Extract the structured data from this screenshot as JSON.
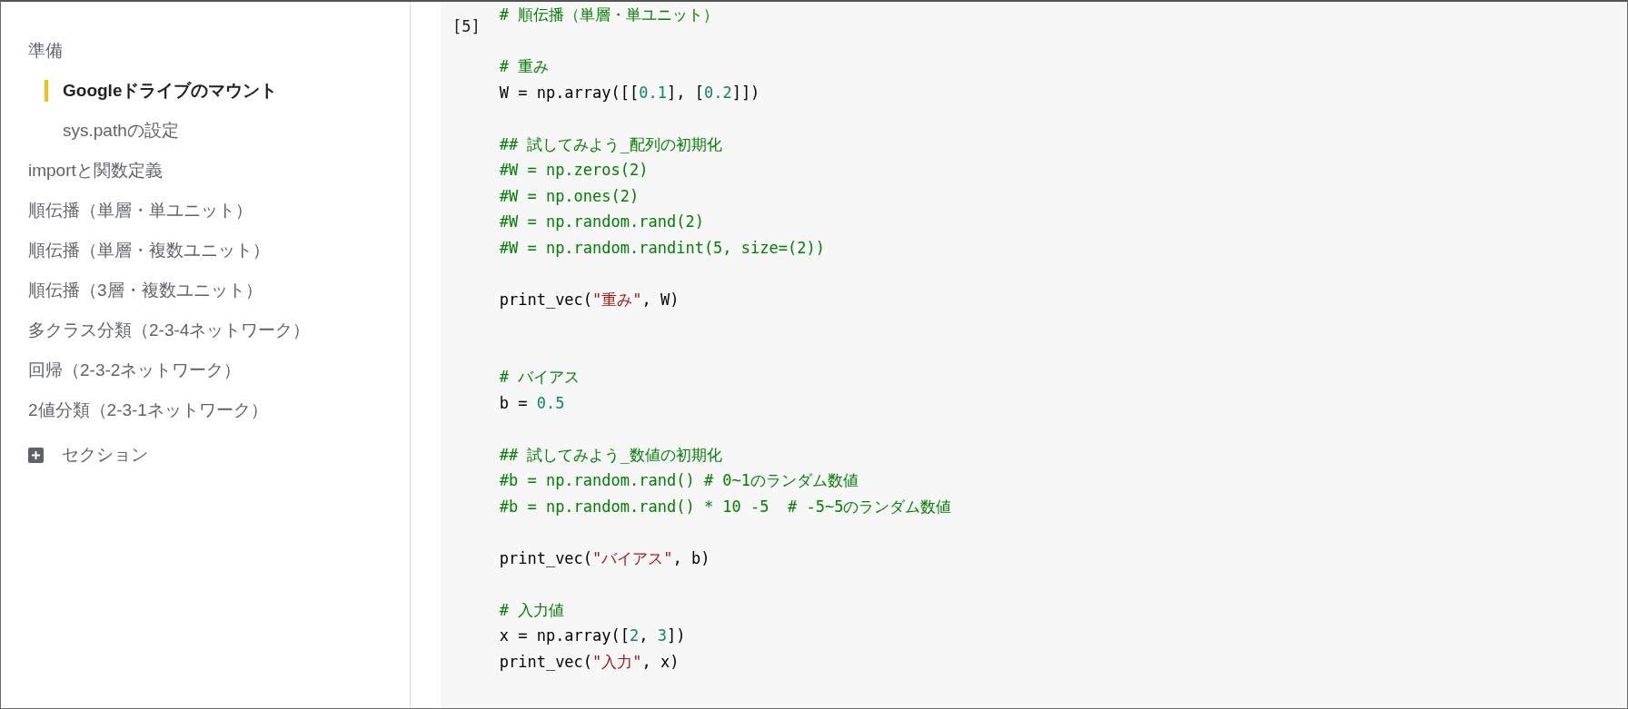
{
  "sidebar": {
    "items": [
      {
        "label": "準備",
        "selected": false,
        "children": [
          {
            "label": "Googleドライブのマウント",
            "selected": true
          },
          {
            "label": "sys.pathの設定",
            "selected": false
          }
        ]
      },
      {
        "label": "importと関数定義",
        "selected": false
      },
      {
        "label": "順伝播（単層・単ユニット）",
        "selected": false
      },
      {
        "label": "順伝播（単層・複数ユニット）",
        "selected": false
      },
      {
        "label": "順伝播（3層・複数ユニット）",
        "selected": false
      },
      {
        "label": "多クラス分類（2-3-4ネットワーク）",
        "selected": false
      },
      {
        "label": "回帰（2-3-2ネットワーク）",
        "selected": false
      },
      {
        "label": "2値分類（2-3-1ネットワーク）",
        "selected": false
      }
    ],
    "add_section": "セクション"
  },
  "cell": {
    "number": "[5]",
    "lines": [
      {
        "kind": "code",
        "segments": [
          {
            "kind": "comment",
            "text": "# 順伝播（単層・単ユニット）"
          }
        ]
      },
      {
        "kind": "blank"
      },
      {
        "kind": "code",
        "segments": [
          {
            "kind": "comment",
            "text": "# 重み"
          }
        ]
      },
      {
        "kind": "code",
        "segments": [
          {
            "kind": "plain",
            "text": "W = np.array([["
          },
          {
            "kind": "number",
            "text": "0.1"
          },
          {
            "kind": "plain",
            "text": "], ["
          },
          {
            "kind": "number",
            "text": "0.2"
          },
          {
            "kind": "plain",
            "text": "]])"
          }
        ]
      },
      {
        "kind": "blank"
      },
      {
        "kind": "code",
        "segments": [
          {
            "kind": "comment",
            "text": "## 試してみよう_配列の初期化"
          }
        ]
      },
      {
        "kind": "code",
        "segments": [
          {
            "kind": "comment",
            "text": "#W = np.zeros(2)"
          }
        ]
      },
      {
        "kind": "code",
        "segments": [
          {
            "kind": "comment",
            "text": "#W = np.ones(2)"
          }
        ]
      },
      {
        "kind": "code",
        "segments": [
          {
            "kind": "comment",
            "text": "#W = np.random.rand(2)"
          }
        ]
      },
      {
        "kind": "code",
        "segments": [
          {
            "kind": "comment",
            "text": "#W = np.random.randint(5, size=(2))"
          }
        ]
      },
      {
        "kind": "blank"
      },
      {
        "kind": "code",
        "segments": [
          {
            "kind": "plain",
            "text": "print_vec("
          },
          {
            "kind": "string",
            "text": "\"重み\""
          },
          {
            "kind": "plain",
            "text": ", W)"
          }
        ]
      },
      {
        "kind": "blank"
      },
      {
        "kind": "blank"
      },
      {
        "kind": "code",
        "segments": [
          {
            "kind": "comment",
            "text": "# バイアス"
          }
        ]
      },
      {
        "kind": "code",
        "segments": [
          {
            "kind": "plain",
            "text": "b = "
          },
          {
            "kind": "number",
            "text": "0.5"
          }
        ]
      },
      {
        "kind": "blank"
      },
      {
        "kind": "code",
        "segments": [
          {
            "kind": "comment",
            "text": "## 試してみよう_数値の初期化"
          }
        ]
      },
      {
        "kind": "code",
        "segments": [
          {
            "kind": "comment",
            "text": "#b = np.random.rand() # 0~1のランダム数値"
          }
        ]
      },
      {
        "kind": "code",
        "segments": [
          {
            "kind": "comment",
            "text": "#b = np.random.rand() * 10 -5  # -5~5のランダム数値"
          }
        ]
      },
      {
        "kind": "blank"
      },
      {
        "kind": "code",
        "segments": [
          {
            "kind": "plain",
            "text": "print_vec("
          },
          {
            "kind": "string",
            "text": "\"バイアス\""
          },
          {
            "kind": "plain",
            "text": ", b)"
          }
        ]
      },
      {
        "kind": "blank"
      },
      {
        "kind": "code",
        "segments": [
          {
            "kind": "comment",
            "text": "# 入力値"
          }
        ]
      },
      {
        "kind": "code",
        "segments": [
          {
            "kind": "plain",
            "text": "x = np.array(["
          },
          {
            "kind": "number",
            "text": "2"
          },
          {
            "kind": "plain",
            "text": ", "
          },
          {
            "kind": "number",
            "text": "3"
          },
          {
            "kind": "plain",
            "text": "])"
          }
        ]
      },
      {
        "kind": "code",
        "segments": [
          {
            "kind": "plain",
            "text": "print_vec("
          },
          {
            "kind": "string",
            "text": "\"入力\""
          },
          {
            "kind": "plain",
            "text": ", x)"
          }
        ]
      }
    ]
  }
}
